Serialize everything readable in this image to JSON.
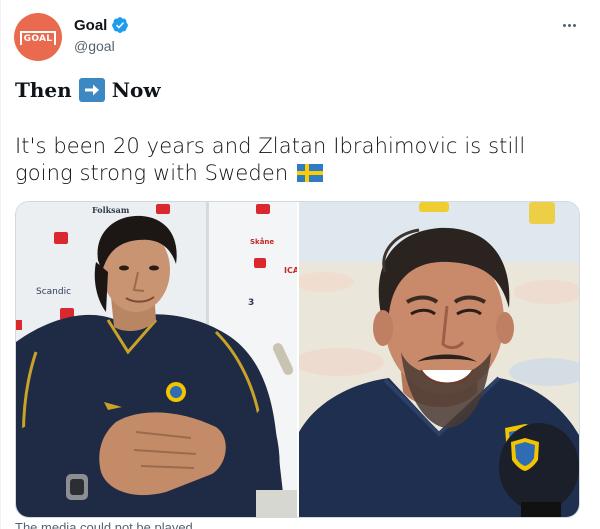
{
  "account": {
    "display_name": "Goal",
    "handle": "@goal",
    "avatar_text": "GOAL",
    "verified": true,
    "avatar_color": "#ea6a4f",
    "verified_color": "#1d9bf0"
  },
  "tweet": {
    "then_text": "Then",
    "now_text": "Now",
    "arrow_icon": "right-arrow-emoji",
    "body_text": "It's been 20 years and Zlatan Ibrahimovic is still going strong with Sweden",
    "flag_icon": "sweden-flag-emoji"
  },
  "media": {
    "photos": [
      {
        "name": "then-photo",
        "backdrop_texts": [
          "Folksam",
          "Scandic",
          "ICA",
          "3",
          "Skåne"
        ]
      },
      {
        "name": "now-photo",
        "backdrop_texts": []
      }
    ]
  },
  "footer": {
    "text": "The media could not be played."
  },
  "colors": {
    "text_primary": "#0f1419",
    "text_secondary": "#536471",
    "arrow_bg": "#3b88c3",
    "sweden_blue": "#2e7bc6",
    "sweden_yellow": "#fecc02"
  }
}
